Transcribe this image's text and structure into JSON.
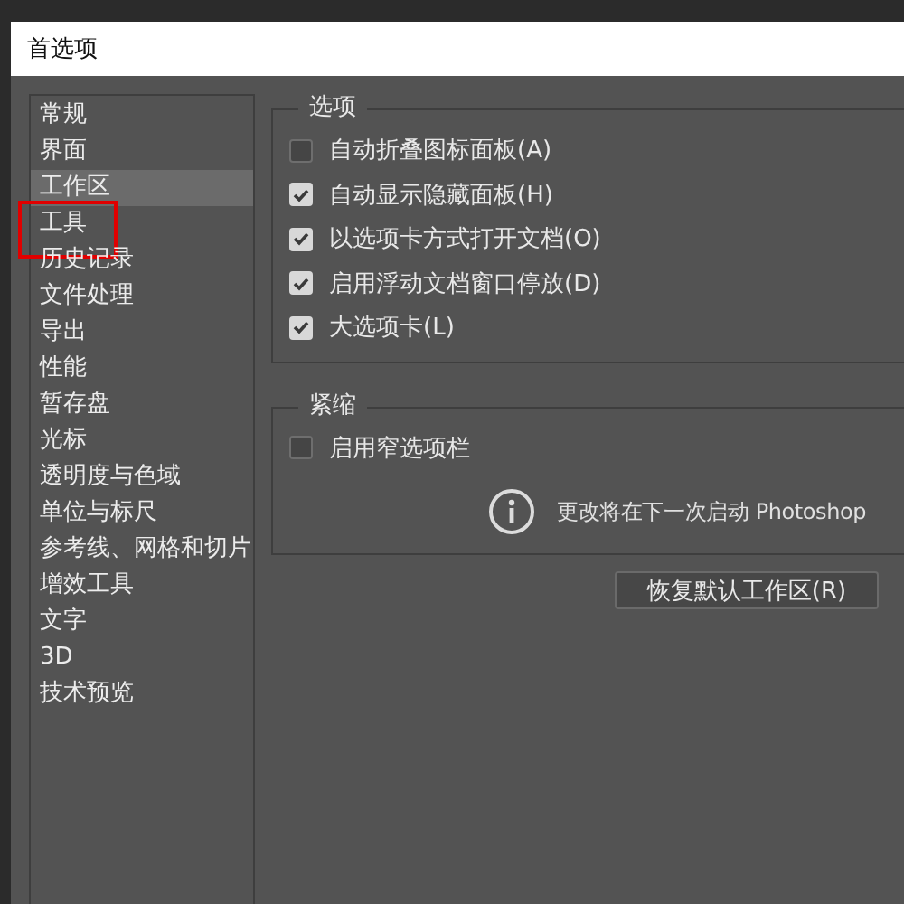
{
  "window": {
    "title": "首选项"
  },
  "sidebar": {
    "items": [
      {
        "label": "常规",
        "selected": false,
        "highlighted": false
      },
      {
        "label": "界面",
        "selected": false,
        "highlighted": false
      },
      {
        "label": "工作区",
        "selected": true,
        "highlighted": false
      },
      {
        "label": "工具",
        "selected": false,
        "highlighted": true
      },
      {
        "label": "历史记录",
        "selected": false,
        "highlighted": false
      },
      {
        "label": "文件处理",
        "selected": false,
        "highlighted": false
      },
      {
        "label": "导出",
        "selected": false,
        "highlighted": false
      },
      {
        "label": "性能",
        "selected": false,
        "highlighted": false
      },
      {
        "label": "暂存盘",
        "selected": false,
        "highlighted": false
      },
      {
        "label": "光标",
        "selected": false,
        "highlighted": false
      },
      {
        "label": "透明度与色域",
        "selected": false,
        "highlighted": false
      },
      {
        "label": "单位与标尺",
        "selected": false,
        "highlighted": false
      },
      {
        "label": "参考线、网格和切片",
        "selected": false,
        "highlighted": false
      },
      {
        "label": "增效工具",
        "selected": false,
        "highlighted": false
      },
      {
        "label": "文字",
        "selected": false,
        "highlighted": false
      },
      {
        "label": "3D",
        "selected": false,
        "highlighted": false
      },
      {
        "label": "技术预览",
        "selected": false,
        "highlighted": false
      }
    ]
  },
  "groups": [
    {
      "title": "选项",
      "options": [
        {
          "label": "自动折叠图标面板(A)",
          "checked": false
        },
        {
          "label": "自动显示隐藏面板(H)",
          "checked": true
        },
        {
          "label": "以选项卡方式打开文档(O)",
          "checked": true
        },
        {
          "label": "启用浮动文档窗口停放(D)",
          "checked": true
        },
        {
          "label": "大选项卡(L)",
          "checked": true
        }
      ]
    },
    {
      "title": "紧缩",
      "options": [
        {
          "label": "启用窄选项栏",
          "checked": false
        }
      ],
      "note": "更改将在下一次启动 Photoshop"
    }
  ],
  "buttons": [
    "恢复默认工作区(R)"
  ]
}
